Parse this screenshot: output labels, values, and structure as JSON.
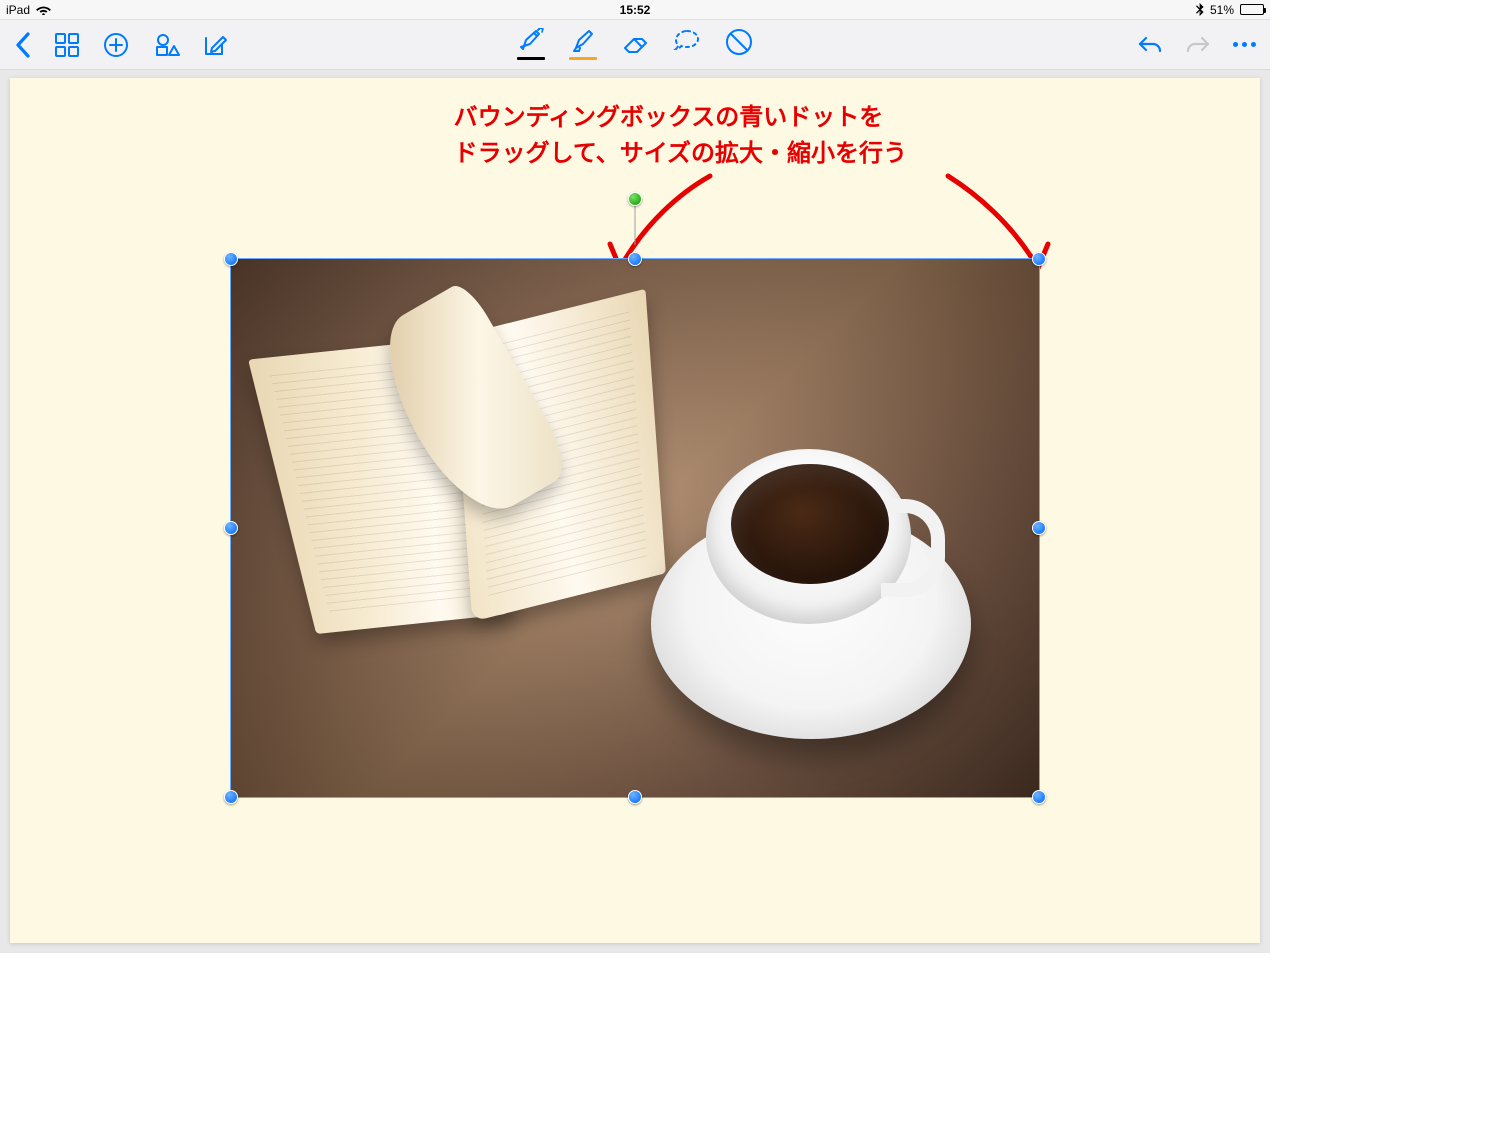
{
  "status": {
    "device": "iPad",
    "time": "15:52",
    "battery_pct": "51%"
  },
  "annotation": {
    "line1": "バウンディングボックスの青いドットを",
    "line2": "ドラッグして、サイズの拡大・縮小を行う"
  },
  "toolbar": {
    "left": {
      "back": "back-chevron-icon",
      "grid": "grid-icon",
      "add": "plus-circle-icon",
      "shapes": "shapes-icon",
      "compose": "compose-icon"
    },
    "center": {
      "pen": "pen-tool-icon",
      "highlighter": "highlighter-tool-icon",
      "eraser": "eraser-tool-icon",
      "lasso": "lasso-tool-icon",
      "text_tool": "text-style-icon"
    },
    "right": {
      "undo": "undo-icon",
      "redo": "redo-icon",
      "more": "more-icon"
    }
  },
  "colors": {
    "ios_blue": "#007aff",
    "annotation_red": "#e60000",
    "page_cream": "#fdf9e3",
    "highlighter_orange": "#f5a623"
  },
  "image_content": "open book and a cup of black coffee on a wooden table",
  "selection": {
    "handle_count": 8,
    "rotation_handle": true
  }
}
